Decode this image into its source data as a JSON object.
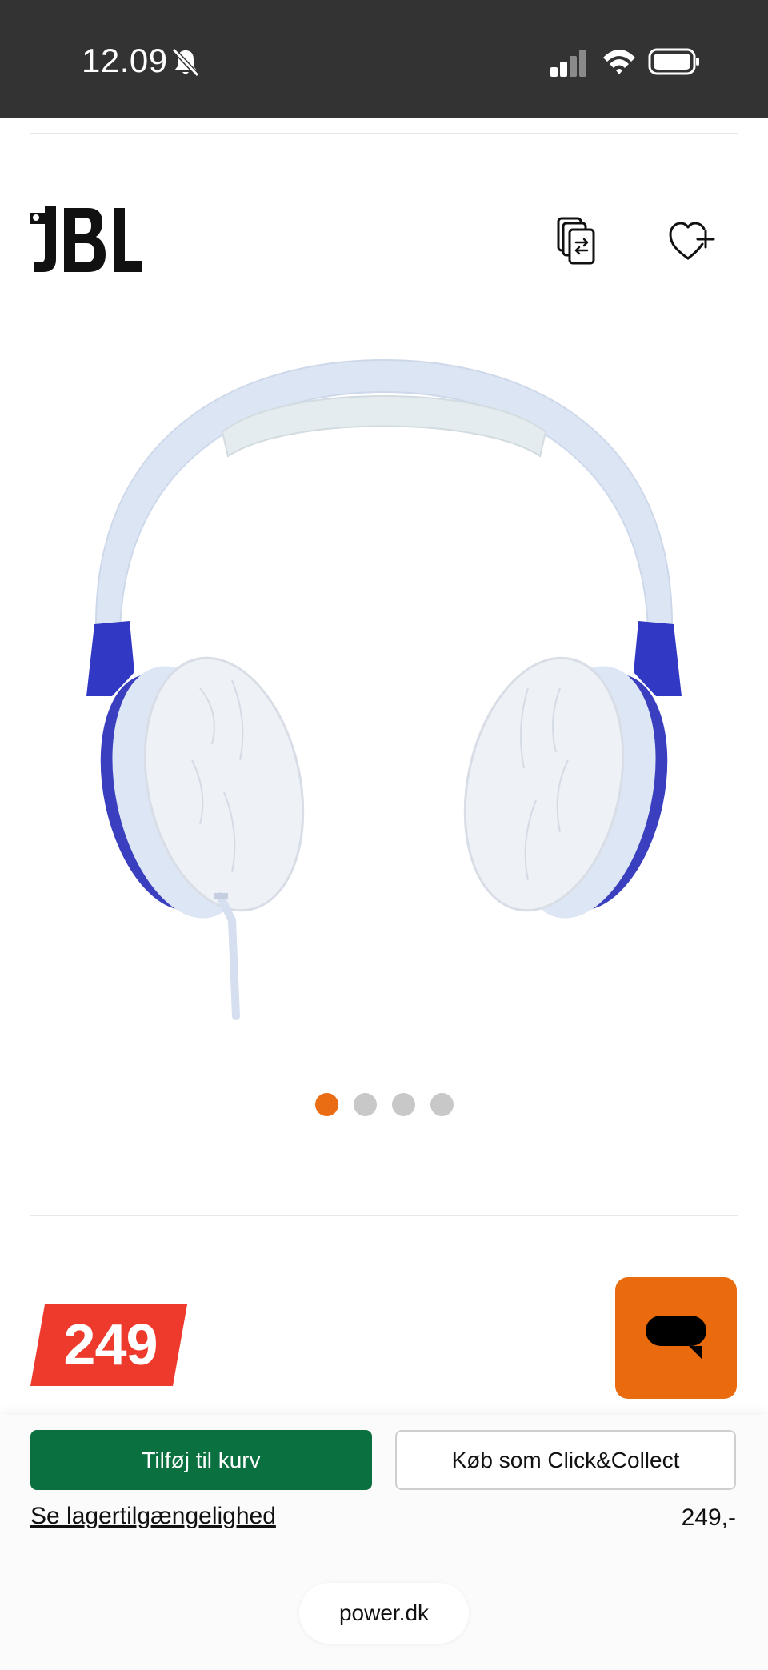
{
  "status_bar": {
    "time": "12.09",
    "icons": [
      "bell-off-icon",
      "signal-icon",
      "wifi-icon",
      "battery-icon"
    ]
  },
  "header": {
    "brand_icon": "jbl-logo",
    "actions": [
      {
        "icon": "compare-icon"
      },
      {
        "icon": "heart-plus-icon"
      }
    ]
  },
  "gallery": {
    "image_icon": "headphones-image",
    "dots_count": 4,
    "active_index": 0
  },
  "price": {
    "tag": "249",
    "tag_color": "#ee3a2c"
  },
  "chat": {
    "icon": "chat-bubble-icon",
    "color": "#ea6a0e"
  },
  "actions": {
    "add_to_cart": "Tilføj til kurv",
    "click_collect": "Køb som Click&Collect",
    "stock_link": "Se lagertilgængelighed",
    "price": "249,-",
    "primary_color": "#0a7040"
  },
  "browser": {
    "url": "power.dk"
  }
}
